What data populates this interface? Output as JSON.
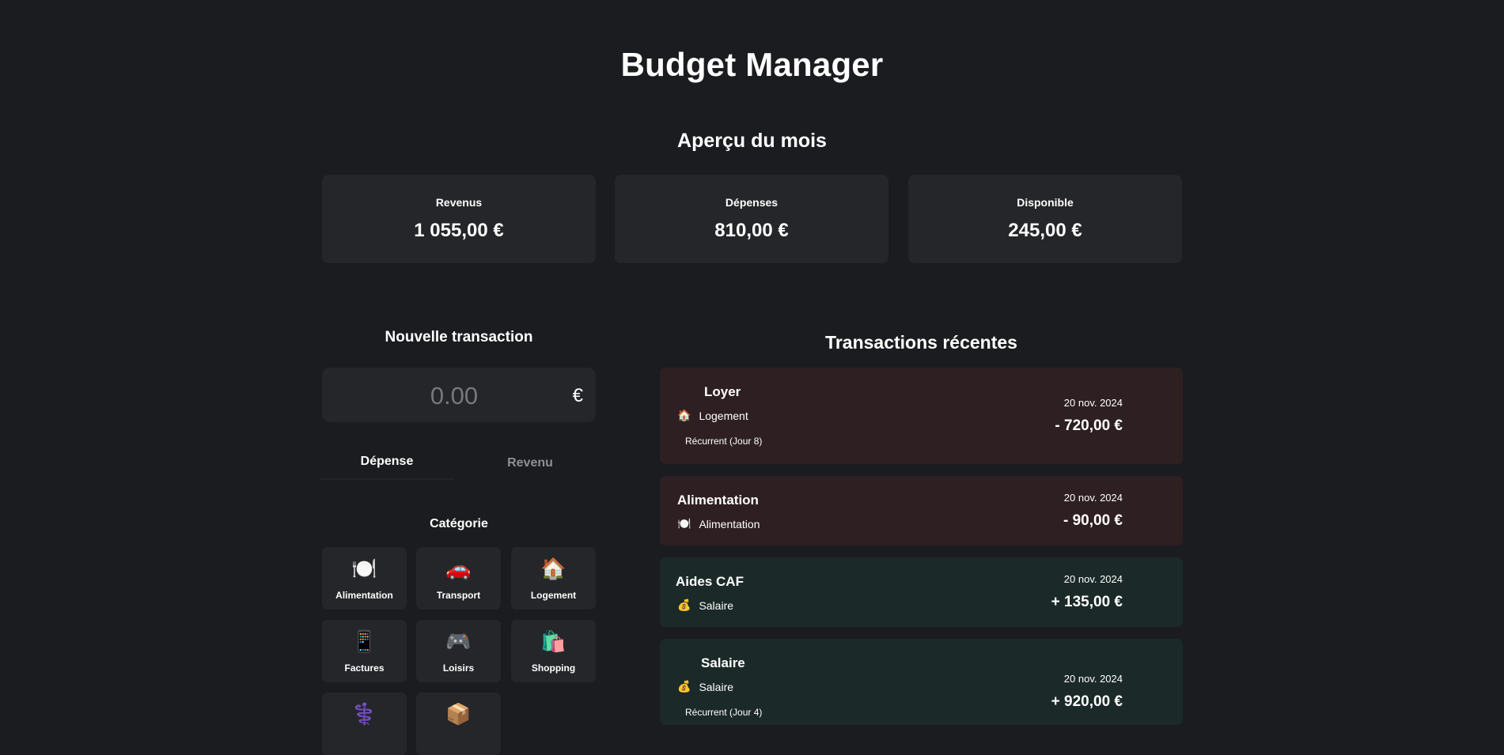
{
  "app": {
    "title": "Budget Manager"
  },
  "overview": {
    "title": "Aperçu du mois",
    "cards": [
      {
        "label": "Revenus",
        "value": "1 055,00 €"
      },
      {
        "label": "Dépenses",
        "value": "810,00 €"
      },
      {
        "label": "Disponible",
        "value": "245,00 €"
      }
    ]
  },
  "form": {
    "title": "Nouvelle transaction",
    "amount_placeholder": "0.00",
    "currency": "€",
    "type_tabs": [
      {
        "label": "Dépense",
        "active": true
      },
      {
        "label": "Revenu",
        "active": false
      }
    ],
    "category_title": "Catégorie",
    "categories": [
      {
        "name": "Alimentation",
        "icon": "🍽️"
      },
      {
        "name": "Transport",
        "icon": "🚗"
      },
      {
        "name": "Logement",
        "icon": "🏠"
      },
      {
        "name": "Factures",
        "icon": "📱"
      },
      {
        "name": "Loisirs",
        "icon": "🎮"
      },
      {
        "name": "Shopping",
        "icon": "🛍️"
      },
      {
        "name": "",
        "icon": "⚕️"
      },
      {
        "name": "",
        "icon": "📦"
      }
    ]
  },
  "transactions": {
    "title": "Transactions récentes",
    "items": [
      {
        "name": "Loyer",
        "category": "Logement",
        "category_icon": "🏠",
        "recurring": "Récurrent (Jour 8)",
        "date": "20 nov. 2024",
        "amount": "- 720,00 €",
        "kind": "expense"
      },
      {
        "name": "Alimentation",
        "category": "Alimentation",
        "category_icon": "🍽️",
        "recurring": "",
        "date": "20 nov. 2024",
        "amount": "- 90,00 €",
        "kind": "expense"
      },
      {
        "name": "Aides CAF",
        "category": "Salaire",
        "category_icon": "💰",
        "recurring": "",
        "date": "20 nov. 2024",
        "amount": "+ 135,00 €",
        "kind": "income"
      },
      {
        "name": "Salaire",
        "category": "Salaire",
        "category_icon": "💰",
        "recurring": "Récurrent (Jour 4)",
        "date": "20 nov. 2024",
        "amount": "+ 920,00 €",
        "kind": "income"
      }
    ]
  }
}
